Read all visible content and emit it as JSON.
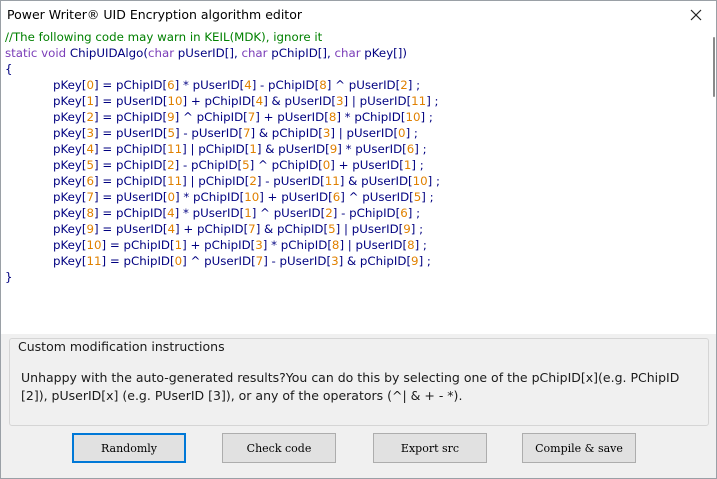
{
  "window": {
    "title": "Power Writer® UID Encryption algorithm editor",
    "close_icon": "close-icon"
  },
  "code": {
    "comment": "//The following code may warn in KEIL(MDK), ignore it",
    "signature": [
      {
        "t": "static void ",
        "c": "keyword"
      },
      {
        "t": "ChipUIDAlgo(",
        "c": "ident"
      },
      {
        "t": "char ",
        "c": "keyword"
      },
      {
        "t": "pUserID[], ",
        "c": "ident"
      },
      {
        "t": "char ",
        "c": "keyword"
      },
      {
        "t": "pChipID[], ",
        "c": "ident"
      },
      {
        "t": "char ",
        "c": "keyword"
      },
      {
        "t": "pKey[])",
        "c": "ident"
      }
    ],
    "open_brace": "{",
    "close_brace": "}",
    "lines": [
      [
        [
          "pKey[",
          "p"
        ],
        [
          "0",
          "n"
        ],
        [
          "] = pChipID[",
          "p"
        ],
        [
          "6",
          "n"
        ],
        [
          "] * pUserID[",
          "p"
        ],
        [
          "4",
          "n"
        ],
        [
          "] - pChipID[",
          "p"
        ],
        [
          "8",
          "n"
        ],
        [
          "] ^ pUserID[",
          "p"
        ],
        [
          "2",
          "n"
        ],
        [
          "] ;",
          "p"
        ]
      ],
      [
        [
          "pKey[",
          "p"
        ],
        [
          "1",
          "n"
        ],
        [
          "] = pUserID[",
          "p"
        ],
        [
          "10",
          "n"
        ],
        [
          "] + pChipID[",
          "p"
        ],
        [
          "4",
          "n"
        ],
        [
          "] & pUserID[",
          "p"
        ],
        [
          "3",
          "n"
        ],
        [
          "] | pUserID[",
          "p"
        ],
        [
          "11",
          "n"
        ],
        [
          "] ;",
          "p"
        ]
      ],
      [
        [
          "pKey[",
          "p"
        ],
        [
          "2",
          "n"
        ],
        [
          "] = pChipID[",
          "p"
        ],
        [
          "9",
          "n"
        ],
        [
          "] ^ pChipID[",
          "p"
        ],
        [
          "7",
          "n"
        ],
        [
          "] + pUserID[",
          "p"
        ],
        [
          "8",
          "n"
        ],
        [
          "] * pChipID[",
          "p"
        ],
        [
          "10",
          "n"
        ],
        [
          "] ;",
          "p"
        ]
      ],
      [
        [
          "pKey[",
          "p"
        ],
        [
          "3",
          "n"
        ],
        [
          "] = pUserID[",
          "p"
        ],
        [
          "5",
          "n"
        ],
        [
          "] - pUserID[",
          "p"
        ],
        [
          "7",
          "n"
        ],
        [
          "] & pChipID[",
          "p"
        ],
        [
          "3",
          "n"
        ],
        [
          "] | pUserID[",
          "p"
        ],
        [
          "0",
          "n"
        ],
        [
          "] ;",
          "p"
        ]
      ],
      [
        [
          "pKey[",
          "p"
        ],
        [
          "4",
          "n"
        ],
        [
          "] = pChipID[",
          "p"
        ],
        [
          "11",
          "n"
        ],
        [
          "] | pChipID[",
          "p"
        ],
        [
          "1",
          "n"
        ],
        [
          "] & pUserID[",
          "p"
        ],
        [
          "9",
          "n"
        ],
        [
          "] * pUserID[",
          "p"
        ],
        [
          "6",
          "n"
        ],
        [
          "] ;",
          "p"
        ]
      ],
      [
        [
          "pKey[",
          "p"
        ],
        [
          "5",
          "n"
        ],
        [
          "] = pChipID[",
          "p"
        ],
        [
          "2",
          "n"
        ],
        [
          "] - pChipID[",
          "p"
        ],
        [
          "5",
          "n"
        ],
        [
          "] ^ pChipID[",
          "p"
        ],
        [
          "0",
          "n"
        ],
        [
          "] + pUserID[",
          "p"
        ],
        [
          "1",
          "n"
        ],
        [
          "] ;",
          "p"
        ]
      ],
      [
        [
          "pKey[",
          "p"
        ],
        [
          "6",
          "n"
        ],
        [
          "] = pChipID[",
          "p"
        ],
        [
          "11",
          "n"
        ],
        [
          "] | pChipID[",
          "p"
        ],
        [
          "2",
          "n"
        ],
        [
          "] - pUserID[",
          "p"
        ],
        [
          "11",
          "n"
        ],
        [
          "] & pUserID[",
          "p"
        ],
        [
          "10",
          "n"
        ],
        [
          "] ;",
          "p"
        ]
      ],
      [
        [
          "pKey[",
          "p"
        ],
        [
          "7",
          "n"
        ],
        [
          "] = pUserID[",
          "p"
        ],
        [
          "0",
          "n"
        ],
        [
          "] * pChipID[",
          "p"
        ],
        [
          "10",
          "n"
        ],
        [
          "] + pUserID[",
          "p"
        ],
        [
          "6",
          "n"
        ],
        [
          "] ^ pUserID[",
          "p"
        ],
        [
          "5",
          "n"
        ],
        [
          "] ;",
          "p"
        ]
      ],
      [
        [
          "pKey[",
          "p"
        ],
        [
          "8",
          "n"
        ],
        [
          "] = pChipID[",
          "p"
        ],
        [
          "4",
          "n"
        ],
        [
          "] * pUserID[",
          "p"
        ],
        [
          "1",
          "n"
        ],
        [
          "] ^ pUserID[",
          "p"
        ],
        [
          "2",
          "n"
        ],
        [
          "] - pChipID[",
          "p"
        ],
        [
          "6",
          "n"
        ],
        [
          "] ;",
          "p"
        ]
      ],
      [
        [
          "pKey[",
          "p"
        ],
        [
          "9",
          "n"
        ],
        [
          "] = pUserID[",
          "p"
        ],
        [
          "4",
          "n"
        ],
        [
          "] + pChipID[",
          "p"
        ],
        [
          "7",
          "n"
        ],
        [
          "] & pChipID[",
          "p"
        ],
        [
          "5",
          "n"
        ],
        [
          "] | pUserID[",
          "p"
        ],
        [
          "9",
          "n"
        ],
        [
          "] ;",
          "p"
        ]
      ],
      [
        [
          "pKey[",
          "p"
        ],
        [
          "10",
          "n"
        ],
        [
          "] = pChipID[",
          "p"
        ],
        [
          "1",
          "n"
        ],
        [
          "] + pChipID[",
          "p"
        ],
        [
          "3",
          "n"
        ],
        [
          "] * pChipID[",
          "p"
        ],
        [
          "8",
          "n"
        ],
        [
          "] | pUserID[",
          "p"
        ],
        [
          "8",
          "n"
        ],
        [
          "] ;",
          "p"
        ]
      ],
      [
        [
          "pKey[",
          "p"
        ],
        [
          "11",
          "n"
        ],
        [
          "] = pChipID[",
          "p"
        ],
        [
          "0",
          "n"
        ],
        [
          "] ^ pUserID[",
          "p"
        ],
        [
          "7",
          "n"
        ],
        [
          "] - pUserID[",
          "p"
        ],
        [
          "3",
          "n"
        ],
        [
          "] & pChipID[",
          "p"
        ],
        [
          "9",
          "n"
        ],
        [
          "] ;",
          "p"
        ]
      ]
    ]
  },
  "instructions": {
    "title": "Custom modification instructions",
    "body": "Unhappy with the auto-generated results?You can do this by selecting one of the pChipID[x](e.g. PChipID [2]), pUserID[x] (e.g. PUserID [3]), or any of the operators (^| & + - *)."
  },
  "buttons": {
    "randomly": "Randomly",
    "check_code": "Check code",
    "export_src": "Export src",
    "compile_save": "Compile & save"
  },
  "colors": {
    "comment": "#008000",
    "keyword": "#7a3db8",
    "identifier": "#000080",
    "number": "#e08000",
    "accent": "#0078d7"
  }
}
